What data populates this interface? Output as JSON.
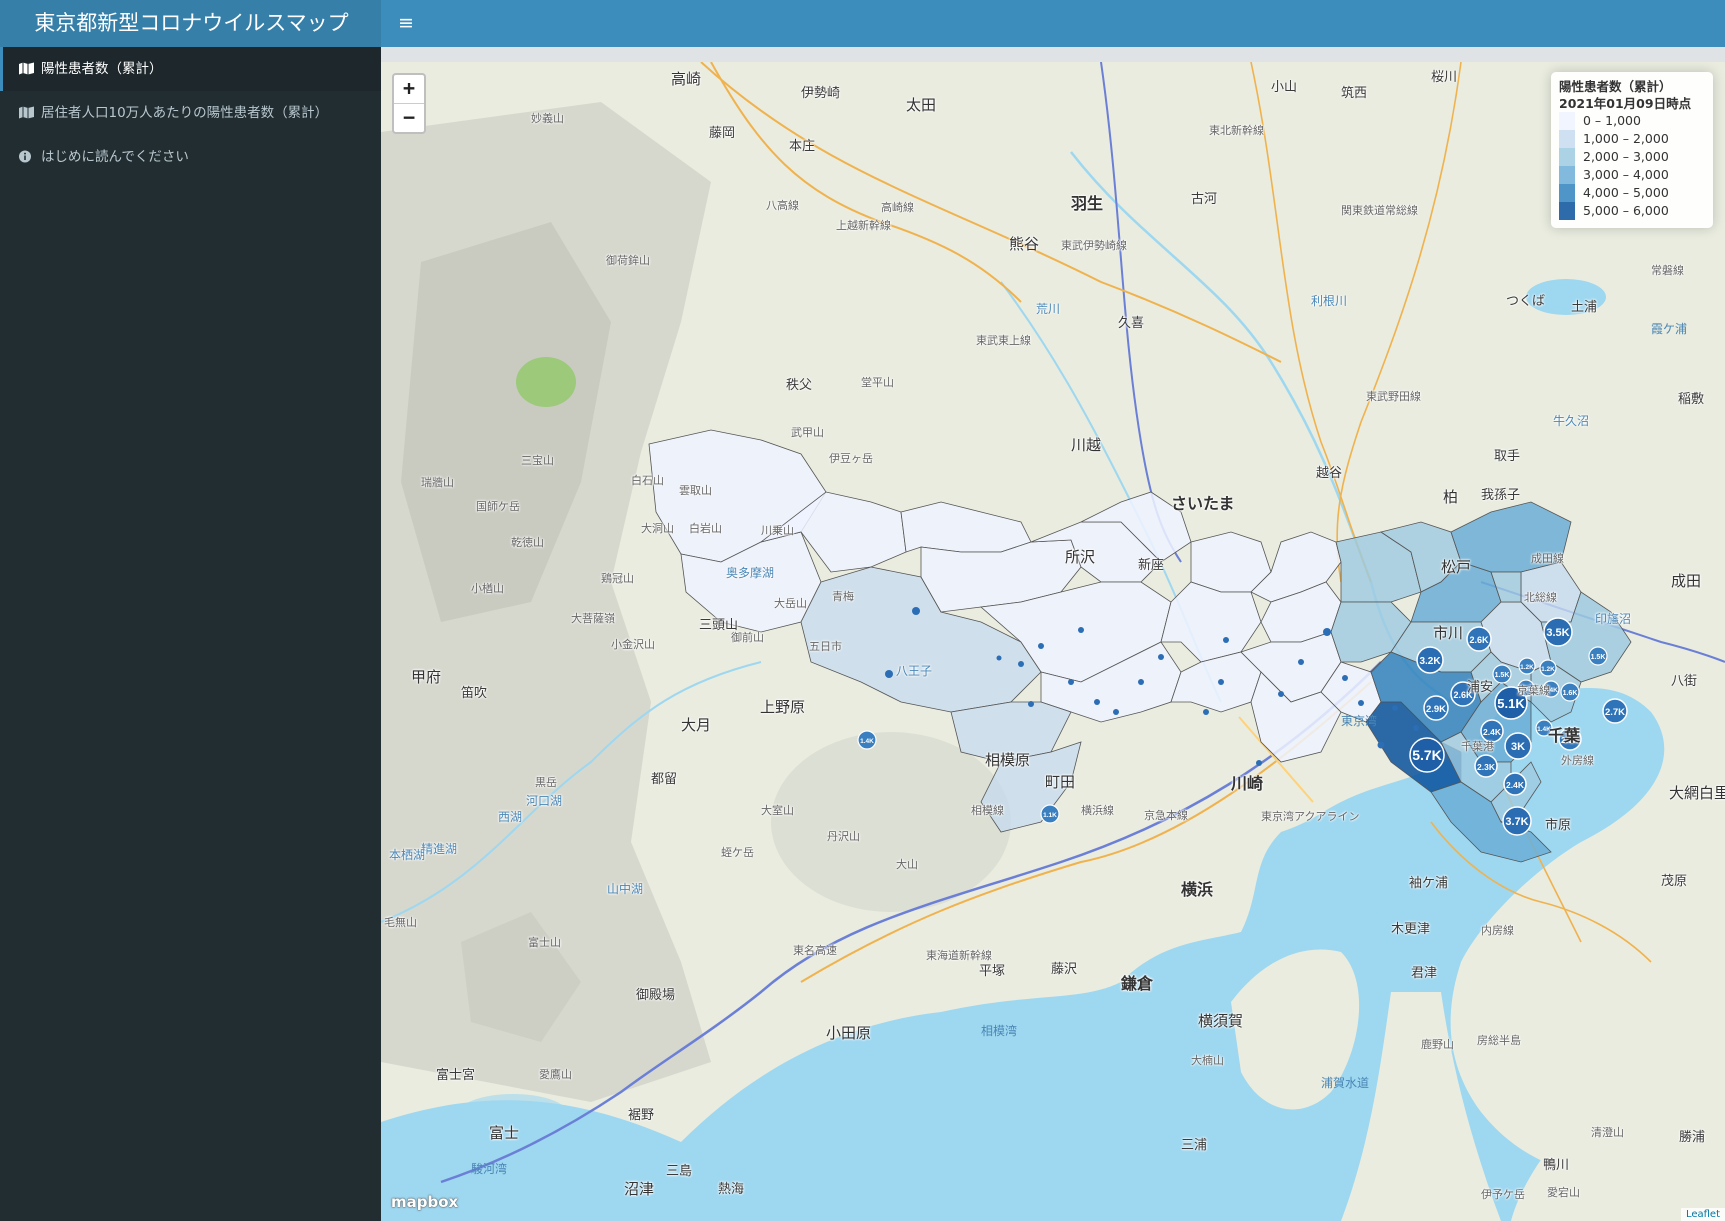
{
  "header": {
    "app_title": "東京都新型コロナウイルスマップ",
    "toggle_icon": "hamburger-icon"
  },
  "sidebar": {
    "items": [
      {
        "label": "陽性患者数（累計）",
        "icon": "map-icon",
        "active": true
      },
      {
        "label": "居住者人口10万人あたりの陽性患者数（累計）",
        "icon": "map-icon",
        "active": false
      },
      {
        "label": "はじめに読んでください",
        "icon": "info-icon",
        "active": false
      }
    ]
  },
  "map": {
    "zoom_in": "+",
    "zoom_out": "−",
    "attribution": "Leaflet",
    "basemap_logo": "mapbox",
    "legend": {
      "title": "陽性患者数（累計）",
      "subtitle": "2021年01月09日時点",
      "bins": [
        {
          "label": "0 – 1,000",
          "color": "#eff3ff"
        },
        {
          "label": "1,000 – 2,000",
          "color": "#c6dbef"
        },
        {
          "label": "2,000 – 3,000",
          "color": "#9ecae1"
        },
        {
          "label": "3,000 – 4,000",
          "color": "#6baed6"
        },
        {
          "label": "4,000 – 5,000",
          "color": "#3182bd"
        },
        {
          "label": "5,000 – 6,000",
          "color": "#08519c"
        }
      ]
    },
    "markers": [
      "5.7K",
      "5.1K",
      "3.7K",
      "3.5K",
      "3.2K",
      "3K",
      "2.9K",
      "2.7K",
      "2.6K",
      "2.6K",
      "2.5K",
      "2.4K",
      "2.4K",
      "2.3K",
      "1.6K",
      "1.5K",
      "1.5K",
      "1.4K",
      "1.4K",
      "1.4K",
      "1.3K",
      "1.2K",
      "1.2K",
      "1.1K"
    ],
    "places": [
      "高崎",
      "伊勢崎",
      "太田",
      "小山",
      "筑西",
      "桜川",
      "藤岡",
      "本庄",
      "羽生",
      "古河",
      "熊谷",
      "八高線",
      "上越新幹線",
      "高崎線",
      "東武伊勢崎線",
      "妙義山",
      "御荷鉾山",
      "荒川",
      "利根川",
      "久喜",
      "つくば",
      "土浦",
      "霞ケ浦",
      "稲敷",
      "秩父",
      "堂平山",
      "武甲山",
      "伊豆ヶ岳",
      "川越",
      "越谷",
      "取手",
      "柏",
      "我孫子",
      "牛久沼",
      "三宝山",
      "白石山",
      "国師ケ岳",
      "大洞山",
      "瑞牆山",
      "乾徳山",
      "鶏冠山",
      "小楢山",
      "小金沢山",
      "三頭山",
      "さいたま",
      "所沢",
      "新座",
      "松戸",
      "市川",
      "浦安",
      "八街",
      "成田",
      "甲府",
      "笛吹",
      "上野原",
      "大月",
      "八王子",
      "相模原",
      "町田",
      "都留",
      "黒岳",
      "西湖",
      "河口湖",
      "大室山",
      "丹沢山",
      "蛭ケ岳",
      "大山",
      "川崎",
      "横浜",
      "東京湾",
      "千葉",
      "市原",
      "袖ケ浦",
      "木更津",
      "君津",
      "茂原",
      "富士山",
      "御殿場",
      "小田原",
      "平塚",
      "藤沢",
      "鎌倉",
      "横須賀",
      "大楠山",
      "三浦",
      "相模湾",
      "浦賀水道",
      "房総半島",
      "鹿野山",
      "清澄山",
      "鴨川",
      "富士宮",
      "愛鷹山",
      "裾野",
      "富士",
      "沼津",
      "三島",
      "熱海",
      "駿河湾",
      "伊予ケ岳",
      "愛宕山",
      "勝浦",
      "毛無山",
      "大網白里",
      "成田線",
      "北総線",
      "京葉線",
      "外房線",
      "内房線",
      "常磐線",
      "東武野田線",
      "東北新幹線",
      "東海道新幹線",
      "相模線",
      "横浜線",
      "東名高速",
      "京急本線",
      "東武東上線",
      "関東鉄道常総線",
      "印旛沼",
      "山中湖",
      "精進湖",
      "本栖湖",
      "雲取山",
      "川乗山",
      "大岳山",
      "御前山",
      "五日市",
      "青梅",
      "奥多摩湖",
      "白岩山",
      "大菩薩嶺",
      "東京湾アクアライン",
      "千葉港"
    ]
  }
}
